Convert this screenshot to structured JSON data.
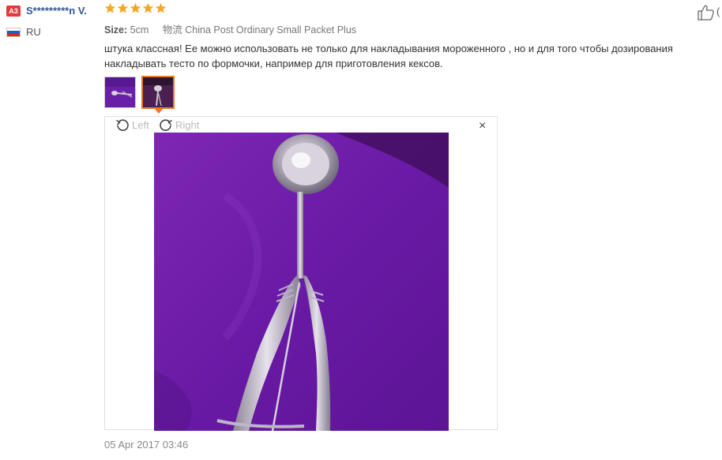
{
  "reviewer": {
    "level_badge": "A3",
    "name": "S*********n V.",
    "country": "RU",
    "flag_colors": [
      "#ffffff",
      "#2c58b8",
      "#d52b1e"
    ]
  },
  "rating": {
    "value": 5,
    "max": 5,
    "color": "#f5a623"
  },
  "helpful": {
    "count_text": "("
  },
  "meta": {
    "size_label": "Size:",
    "size_value": "5cm",
    "shipping_label": "物流",
    "shipping_value": "China Post Ordinary Small Packet Plus"
  },
  "review_text": "штука классная! Ее можно использовать не только для накладывания мороженного , но и для того чтобы дозирования накладывать тесто по формочки, например для приготовления кексов.",
  "viewer": {
    "rotate_left_label": "Left",
    "rotate_right_label": "Right",
    "close_label": "×"
  },
  "date": "05 Apr 2017 03:46",
  "colors": {
    "accent": "#e7792c",
    "name": "#2f5596",
    "photo_bg": "#7a1fb0"
  }
}
